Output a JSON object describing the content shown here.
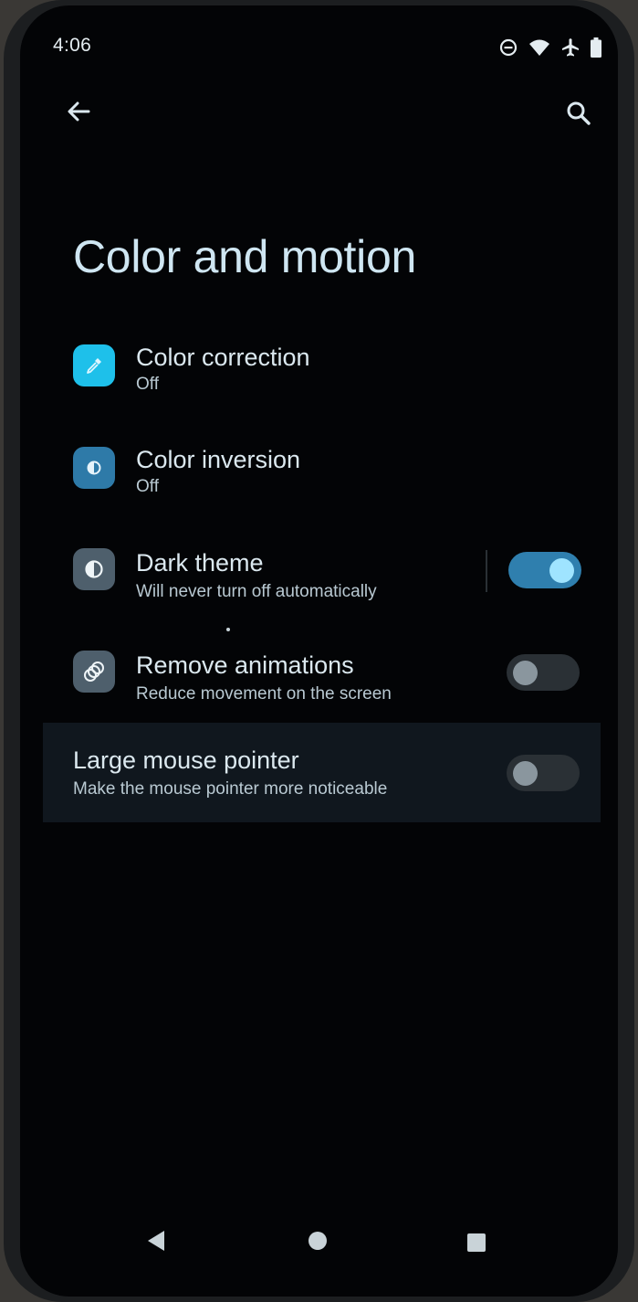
{
  "status_bar": {
    "time": "4:06",
    "icons": [
      "do-not-disturb-icon",
      "wifi-icon",
      "airplane-icon",
      "battery-icon"
    ]
  },
  "top_bar": {
    "back_icon": "arrow-left-icon",
    "search_icon": "search-icon"
  },
  "page": {
    "title": "Color and motion"
  },
  "settings": [
    {
      "key": "color_correction",
      "title": "Color correction",
      "subtitle": "Off",
      "icon": "eyedropper-icon",
      "icon_bg": "#1ec0ea"
    },
    {
      "key": "color_inversion",
      "title": "Color inversion",
      "subtitle": "Off",
      "icon": "invert-colors-icon",
      "icon_bg": "#2e7aa8"
    },
    {
      "key": "dark_theme",
      "title": "Dark theme",
      "subtitle": "Will never turn off automatically",
      "icon": "contrast-icon",
      "icon_bg": "#4e5f6c",
      "toggle": true
    },
    {
      "key": "remove_animations",
      "title": "Remove animations",
      "subtitle": "Reduce movement on the screen",
      "icon": "animation-icon",
      "icon_bg": "#4e5f6c",
      "toggle": false
    },
    {
      "key": "large_mouse_pointer",
      "title": "Large mouse pointer",
      "subtitle": "Make the mouse pointer more noticeable",
      "toggle": false
    }
  ],
  "nav_bar": {
    "back_icon": "nav-back-icon",
    "home_icon": "nav-home-icon",
    "recents_icon": "nav-recents-icon"
  },
  "colors": {
    "background": "#030406",
    "accent": "#2f7fae",
    "toggle_knob_on": "#9fe4ff",
    "title_text": "#cfe6f2"
  }
}
